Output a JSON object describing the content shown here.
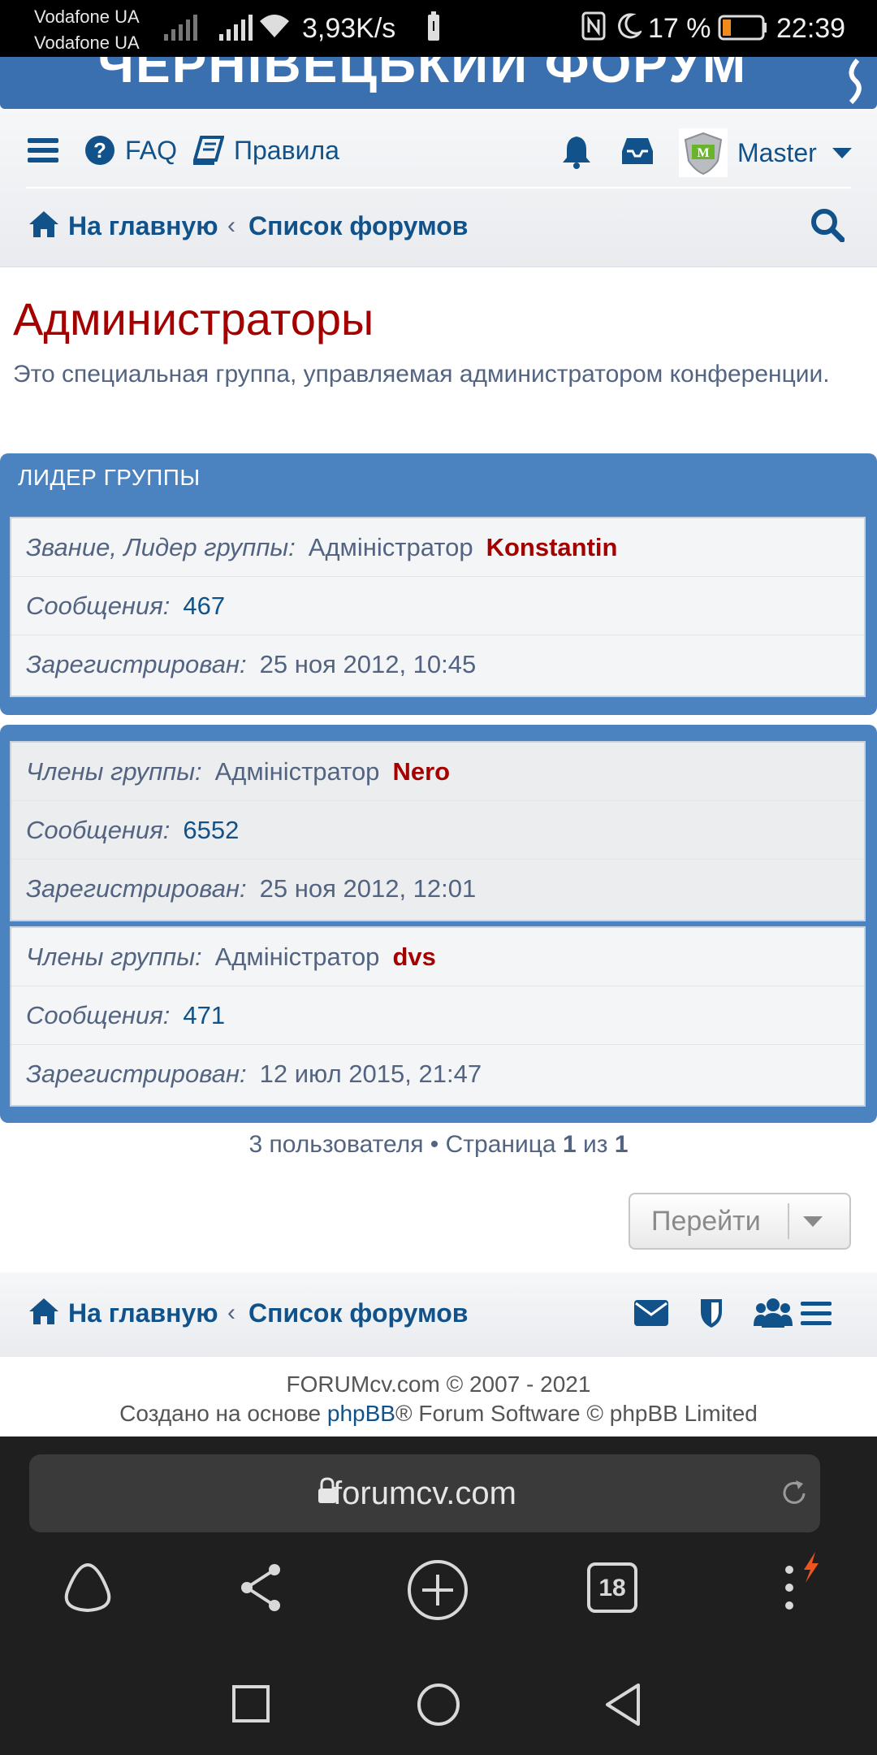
{
  "status_bar": {
    "carrier1": "Vodafone UA",
    "carrier2": "Vodafone UA",
    "speed": "3,93K/s",
    "battery": "17 %",
    "time": "22:39"
  },
  "site": {
    "title": "ЧЕРНІВЕЦЬКИЙ ФОРУМ",
    "accent": "#105289",
    "header_color": "#3a6fb0"
  },
  "nav": {
    "faq": "FAQ",
    "rules": "Правила",
    "username": "Master",
    "breadcrumb_home": "На главную",
    "breadcrumb_sep": "‹",
    "breadcrumb_forums": "Список форумов"
  },
  "page": {
    "title": "Администраторы",
    "description": "Это специальная группа, управляемая администратором конференции."
  },
  "leader_panel": {
    "header": "ЛИДЕР ГРУППЫ",
    "member": {
      "rank_label": "Звание, Лидер группы:",
      "rank": "Адміністратор",
      "name": "Konstantin",
      "posts_label": "Сообщения:",
      "posts": "467",
      "registered_label": "Зарегистрирован:",
      "registered": "25 ноя 2012, 10:45"
    }
  },
  "members": [
    {
      "rank_label": "Члены группы:",
      "rank": "Адміністратор",
      "name": "Nero",
      "posts_label": "Сообщения:",
      "posts": "6552",
      "registered_label": "Зарегистрирован:",
      "registered": "25 ноя 2012, 12:01"
    },
    {
      "rank_label": "Члены группы:",
      "rank": "Адміністратор",
      "name": "dvs",
      "posts_label": "Сообщения:",
      "posts": "471",
      "registered_label": "Зарегистрирован:",
      "registered": "12 июл 2015, 21:47"
    }
  ],
  "pagination": {
    "count_text": "3 пользователя • Страница",
    "current": "1",
    "of": "из",
    "total": "1",
    "jump_label": "Перейти"
  },
  "footer": {
    "line1": "FORUMcv.com © 2007 - 2021",
    "line2_pre": "Создано на основе",
    "line2_link": "phpBB",
    "line2_post": "® Forum Software © phpBB Limited"
  },
  "browser": {
    "url": "forumcv.com",
    "tabs_count": "18"
  },
  "icons": {
    "menu": "hamburger-icon",
    "faq": "question-circle-icon",
    "rules": "book-icon",
    "notifications": "bell-icon",
    "messages": "inbox-icon",
    "search": "search-icon",
    "home": "home-icon"
  }
}
